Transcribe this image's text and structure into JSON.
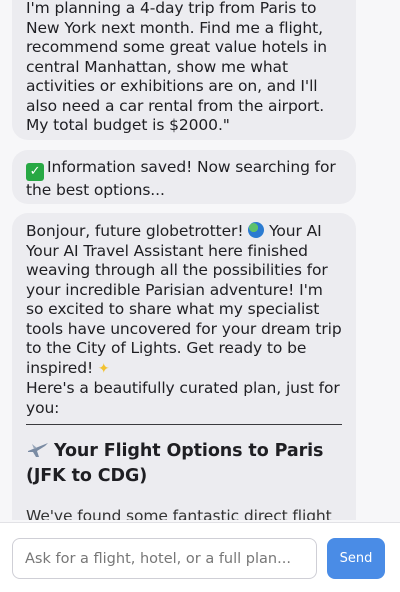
{
  "messages": {
    "user_request": "I'm planning a 4-day trip from Paris to New York next month. Find me a flight, recommend some great value hotels in central Manhattan, show me what activities or exhibitions are on, and I'll also need a car rental from the airport. My total budget is $2000.\"",
    "saved_notice": "Information saved! Now searching for the best options...",
    "assistant_intro_1": "Bonjour, future globetrotter!",
    "assistant_intro_2": "Your AI Your AI Travel Assistant here",
    "assistant_intro_3": "finished weaving through all the possibilities for your incredible Parisian adventure! I'm so excited to share what my specialist tools have uncovered for your dream trip to the City of Lights. Get ready to be inspired!",
    "assistant_plan_intro": "Here's a beautifully curated plan, just for you:",
    "flight_heading": "Your Flight Options to Paris (JFK to CDG)",
    "cutoff_text": "We've found some fantastic direct flight"
  },
  "composer": {
    "placeholder": "Ask for a flight, hotel, or a full plan...",
    "send_label": "Send"
  },
  "icons": {
    "check": "check-mark-icon",
    "globe": "globe-icon",
    "sparkles": "sparkles-icon",
    "airplane": "airplane-icon"
  },
  "colors": {
    "bubble": "#ececf0",
    "send": "#4a8ce6",
    "check": "#27a844"
  }
}
